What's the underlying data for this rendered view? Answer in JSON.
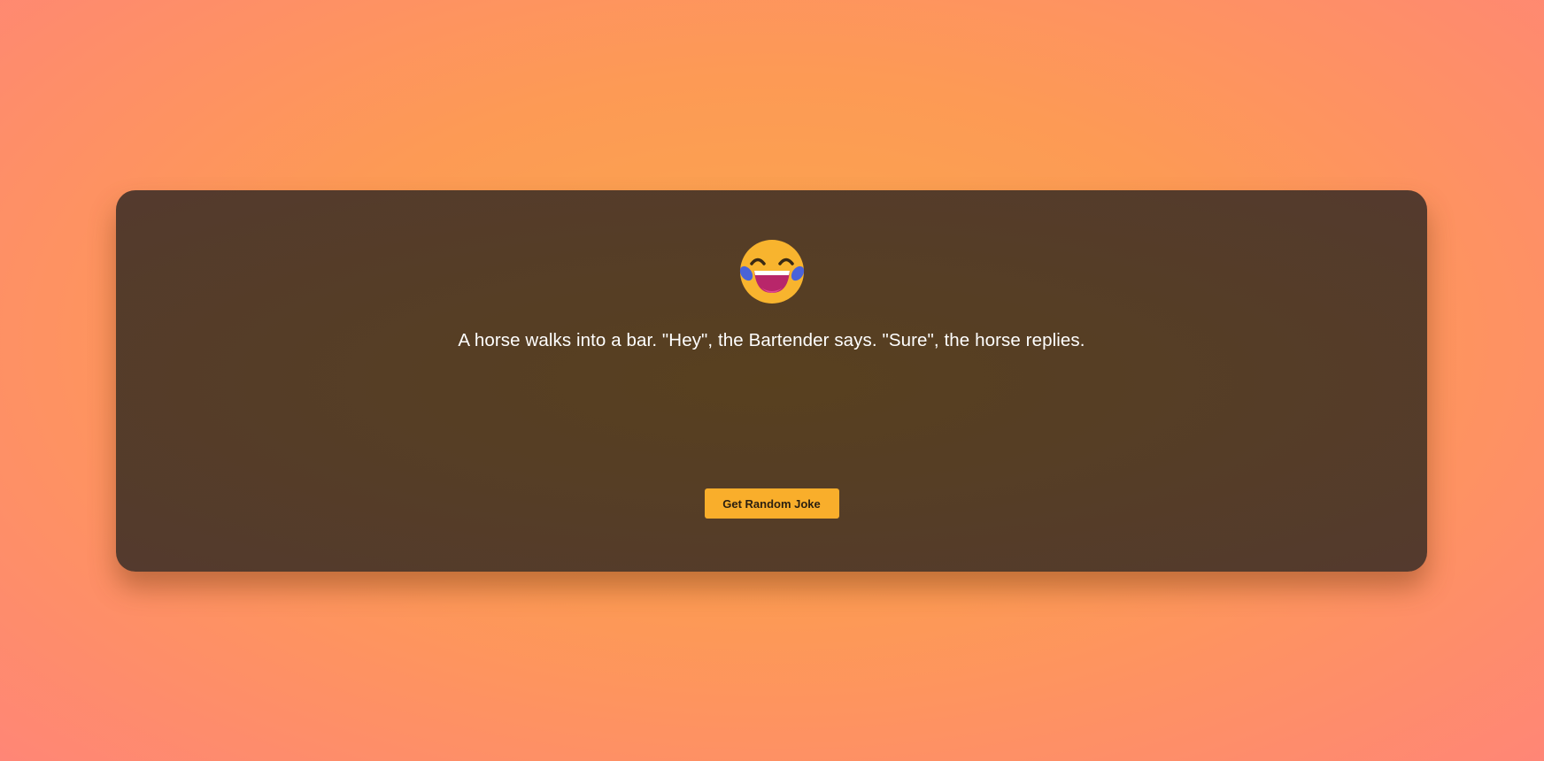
{
  "app": {
    "emoji_icon": "face-with-tears-of-joy-icon",
    "joke_text": "A horse walks into a bar. \"Hey\", the Bartender says. \"Sure\", the horse replies.",
    "button_label": "Get Random Joke"
  },
  "colors": {
    "accent": "#f9ae2b",
    "card_background": "#553d27",
    "text": "#ffffff"
  }
}
